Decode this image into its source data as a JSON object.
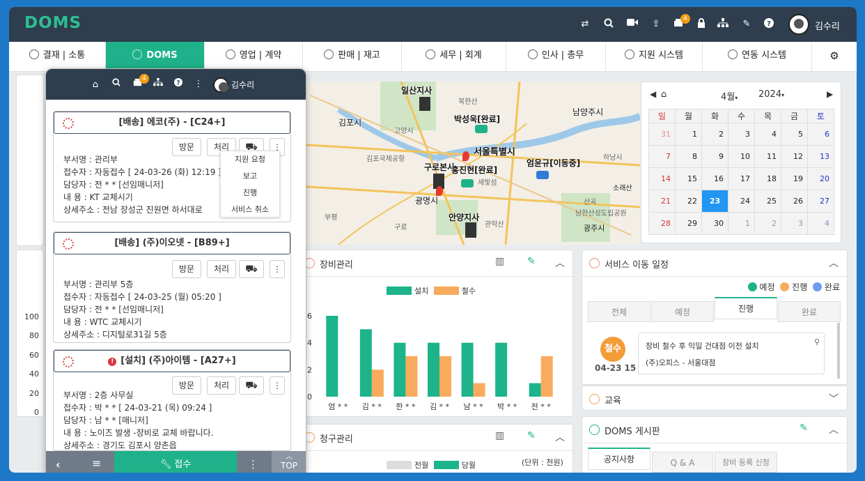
{
  "app": {
    "logo": "DOMS",
    "user_name": "김수리",
    "print_badge": "4"
  },
  "menu": [
    {
      "label": "결재 | 소통",
      "icon": "approval-icon"
    },
    {
      "label": "DOMS",
      "icon": "doms-icon"
    },
    {
      "label": "영업 | 계약",
      "icon": "sales-icon"
    },
    {
      "label": "판매 | 재고",
      "icon": "cart-icon"
    },
    {
      "label": "세무 | 회계",
      "icon": "won-icon"
    },
    {
      "label": "인사 | 총무",
      "icon": "hr-icon"
    },
    {
      "label": "지원 시스템",
      "icon": "support-icon"
    },
    {
      "label": "연동 시스템",
      "icon": "link-icon"
    }
  ],
  "popup": {
    "user_name": "김수리",
    "badge": "4",
    "cards": [
      {
        "title": "[배송] 에코(주) - [C24+]",
        "dept": "부서명 : 관리부",
        "recv": "접수자 : 자동접수 [ 24-03-26 (화) 12:19 ]",
        "mgr": "담당자 : 전 * * [선임매니저]",
        "content": "내    용 : KT 교체시기",
        "addr": "상세주소 : 전남 장성군 진원면 하서대로"
      },
      {
        "title": "[배송] (주)이오넷 - [B89+]",
        "dept": "부서명 : 관리부 5층",
        "recv": "접수자 : 자동접수 [ 24-03-25 (월) 05:20 ]",
        "mgr": "담당자 : 전 * * [선임매니저]",
        "content": "내    용 : WTC 교체시기",
        "addr": "상세주소 : 디지털로31길  5층"
      },
      {
        "title": "[설치] (주)아이템 - [A27+]",
        "dept": "부서명 : 2층 사무실",
        "recv": "접수자 : 박 * *  [ 24-03-21 (목) 09:24 ]",
        "mgr": "담당자 : 남 * * [매니저]",
        "content": "내    용 : 노이즈 발생 -장비로 교체 바랍니다.",
        "addr": "상세주소 : 경기도 김포시 양촌읍"
      }
    ],
    "buttons": {
      "visit": "방문",
      "process": "처리"
    },
    "dropdown": [
      "지원 요청",
      "보고",
      "진행",
      "서비스 취소"
    ],
    "footer": {
      "receive": "접수",
      "top": "TOP"
    }
  },
  "map": {
    "labels": [
      "일산지사",
      "박성욱[완료]",
      "서울특별시",
      "김포시",
      "구로본사",
      "홍진현[완료]",
      "엄윤규[이동중]",
      "광명시",
      "안양지사",
      "남양주시",
      "소래산"
    ],
    "small": [
      "북한산",
      "김포국제공항",
      "세빛섬",
      "관악산",
      "남한산성도립공원",
      "산곡",
      "광주시",
      "고양시",
      "부평",
      "구로",
      "하남시"
    ]
  },
  "calendar": {
    "month": "4월",
    "year": "2024",
    "weekdays": [
      "일",
      "월",
      "화",
      "수",
      "목",
      "금",
      "토"
    ],
    "weeks": [
      [
        "31",
        "1",
        "2",
        "3",
        "4",
        "5",
        "6"
      ],
      [
        "7",
        "8",
        "9",
        "10",
        "11",
        "12",
        "13"
      ],
      [
        "14",
        "15",
        "16",
        "17",
        "18",
        "19",
        "20"
      ],
      [
        "21",
        "22",
        "23",
        "24",
        "25",
        "26",
        "27"
      ],
      [
        "28",
        "29",
        "30",
        "1",
        "2",
        "3",
        "4"
      ]
    ],
    "today": "23"
  },
  "equipment": {
    "title": "장비관리"
  },
  "chart_data": {
    "type": "bar",
    "categories": [
      "엄 * *",
      "김 * *",
      "한 * *",
      "김 * *",
      "남 * *",
      "박 * *",
      "전 * *"
    ],
    "series": [
      {
        "name": "설치",
        "values": [
          6,
          5,
          4,
          4,
          4,
          4,
          1
        ]
      },
      {
        "name": "철수",
        "values": [
          0,
          2,
          3,
          3,
          1,
          0,
          3
        ]
      }
    ],
    "ylim": [
      0,
      6
    ],
    "yticks": [
      0,
      2,
      4,
      6
    ],
    "colors": [
      "#1db38b",
      "#f8ab5d"
    ]
  },
  "left_axis": [
    "100",
    "80",
    "60",
    "40",
    "20",
    "0"
  ],
  "billing": {
    "title": "청구관리",
    "legend": [
      "전월",
      "당월"
    ],
    "unit": "(단위 : 천원)"
  },
  "schedule": {
    "title": "서비스 이동 일정",
    "legend": [
      "예정",
      "진행",
      "완료"
    ],
    "tabs": [
      "전체",
      "예정",
      "진행",
      "완료"
    ],
    "item": {
      "status": "철수",
      "date": "04-23 15",
      "desc": "장비 철수 후 익일 건대점 이전 설치",
      "place": "(주)오피스 - 서울대점"
    }
  },
  "education": {
    "title": "교육"
  },
  "board": {
    "title": "DOMS 게시판",
    "tabs": [
      "공지사항",
      "Q & A",
      "장비 등록 신청"
    ]
  }
}
